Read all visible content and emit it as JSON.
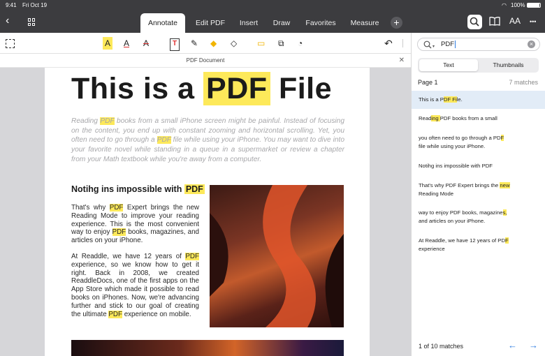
{
  "status": {
    "time": "9:41",
    "date": "Fri Oct 19",
    "battery": "100%"
  },
  "tabs": [
    "Annotate",
    "Edit PDF",
    "Insert",
    "Draw",
    "Favorites",
    "Measure"
  ],
  "icons": {
    "back": "chevron-left-icon",
    "grid": "grid-icon",
    "plus": "plus-icon",
    "search": "search-icon",
    "book": "book-icon",
    "text": "text-size-icon",
    "more": "more-icon"
  },
  "textsize": "AA",
  "more": "•••",
  "plus": "+",
  "back": "‹",
  "tools": [
    "A",
    "A",
    "A",
    "T",
    "✎",
    "◆",
    "◇",
    "▭",
    "⧉",
    "◔",
    "↶"
  ],
  "document": {
    "header": "PDF Document",
    "close": "✕",
    "title_pre": "This is a ",
    "title_hl": "PDF",
    "title_post": " File",
    "intro": [
      {
        "t": "Reading "
      },
      {
        "t": "PDF",
        "h": true
      },
      {
        "t": " books from a small iPhone screen might be painful. Instead of focusing on the content, you end up with constant zooming and horizontal scrolling. Yet, you often need to go through a "
      },
      {
        "t": "PDF",
        "h": true
      },
      {
        "t": " file while using your iPhone. You may want to dive into your favorite novel while standing in a queue in a supermarket or review a chapter from your Math textbook while you're away from a computer."
      }
    ],
    "heading_pre": "Notihg ins impossible with ",
    "heading_hl": "PDF",
    "p1": [
      {
        "t": "That's why "
      },
      {
        "t": "PDF",
        "h": true
      },
      {
        "t": " Expert brings the new Reading Mode to improve your reading experience. This is the most convenient way to enjoy "
      },
      {
        "t": "PDF",
        "h": true
      },
      {
        "t": " books, magazines, and articles on your iPhone."
      }
    ],
    "p2": [
      {
        "t": "At Readdle, we have 12 years of "
      },
      {
        "t": "PDF",
        "h": true
      },
      {
        "t": " experience, so we know how to get it right. Back in 2008, we created ReaddleDocs, one of the first apps on the App Store which made it possible to read books on iPhones. Now, we're advancing further and stick to our goal of creating the ultimate "
      },
      {
        "t": "PDF",
        "h": true
      },
      {
        "t": " experience on mobile."
      }
    ]
  },
  "search": {
    "query": "PDF",
    "seg_text": "Text",
    "seg_thumbs": "Thumbnails",
    "page_label": "Page 1",
    "matches": "7 matches",
    "footer": "1 of 10 matches",
    "clear": "×",
    "results": [
      [
        {
          "t": "This is a P"
        },
        {
          "t": "DF Fi",
          "h": true
        },
        {
          "t": "le."
        }
      ],
      [
        {
          "t": "Read"
        },
        {
          "t": "ing ",
          "h": true
        },
        {
          "t": "PDF books from a small"
        }
      ],
      [
        {
          "t": "you often need to go through a PD"
        },
        {
          "t": "F",
          "h": true
        },
        {
          "t": "\nfile while using your iPhone."
        }
      ],
      [
        {
          "t": "Notihg ins impossible with PDF      "
        },
        {
          "t": "    ",
          "h": true
        }
      ],
      [
        {
          "t": "That's why PDF Expert brings the "
        },
        {
          "t": "new",
          "h": true
        },
        {
          "t": "\nReading Mode"
        }
      ],
      [
        {
          "t": "way to enjoy PDF books, magazine"
        },
        {
          "t": "s,",
          "h": true
        },
        {
          "t": "\nand articles on your iPhone."
        }
      ],
      [
        {
          "t": "At Readdle, we have 12 years of PD"
        },
        {
          "t": "F",
          "h": true
        },
        {
          "t": "\nexperience"
        }
      ]
    ]
  },
  "colors": {
    "accent": "#2f7de1",
    "highlight": "#fde95a",
    "topbar": "#3c3c3f"
  }
}
